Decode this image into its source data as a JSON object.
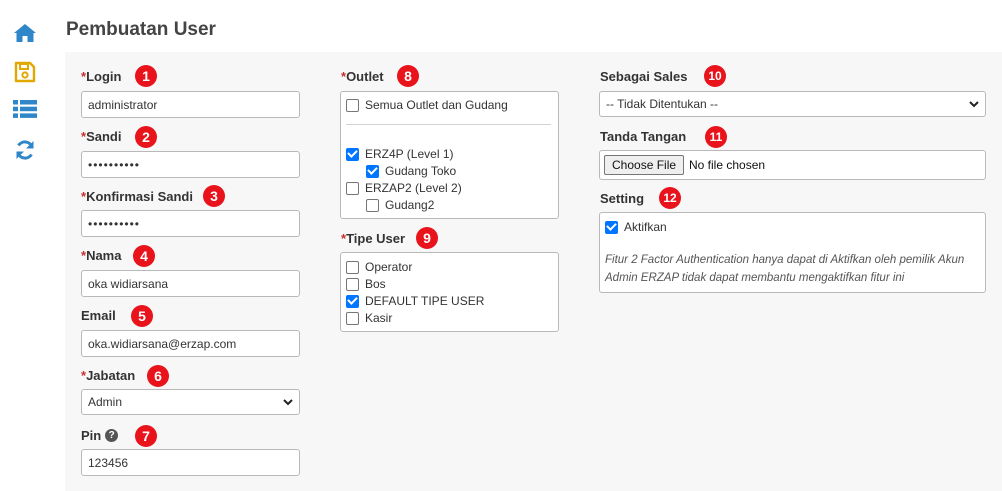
{
  "page": {
    "title": "Pembuatan User"
  },
  "sidebar": {
    "icons": [
      "home-icon",
      "save-icon",
      "list-icon",
      "refresh-icon"
    ]
  },
  "form": {
    "login": {
      "label": "Login",
      "required_mark": "*",
      "badge": "1",
      "value": "administrator"
    },
    "sandi": {
      "label": "Sandi",
      "required_mark": "*",
      "badge": "2",
      "value": "••••••••••"
    },
    "konfirmasi": {
      "label": "Konfirmasi Sandi",
      "required_mark": "*",
      "badge": "3",
      "value": "••••••••••"
    },
    "nama": {
      "label": "Nama",
      "required_mark": "*",
      "badge": "4",
      "value": "oka widiarsana"
    },
    "email": {
      "label": "Email",
      "badge": "5",
      "value": "oka.widiarsana@erzap.com"
    },
    "jabatan": {
      "label": "Jabatan",
      "required_mark": "*",
      "badge": "6",
      "value": "Admin"
    },
    "pin": {
      "label": "Pin",
      "badge": "7",
      "help": "?",
      "value": "123456"
    }
  },
  "outlet": {
    "label": "Outlet",
    "required_mark": "*",
    "badge": "8",
    "all_label": "Semua Outlet dan Gudang",
    "all_checked": false,
    "items": [
      {
        "label": "ERZ4P (Level 1)",
        "checked": true
      },
      {
        "label": "Gudang Toko",
        "checked": true
      },
      {
        "label": "ERZAP2 (Level 2)",
        "checked": false
      },
      {
        "label": "Gudang2",
        "checked": false
      }
    ]
  },
  "tipe_user": {
    "label": "Tipe User",
    "required_mark": "*",
    "badge": "9",
    "items": [
      {
        "label": "Operator",
        "checked": false
      },
      {
        "label": "Bos",
        "checked": false
      },
      {
        "label": "DEFAULT TIPE USER",
        "checked": true
      },
      {
        "label": "Kasir",
        "checked": false
      }
    ]
  },
  "sales": {
    "label": "Sebagai Sales",
    "badge": "10",
    "value": "-- Tidak Ditentukan --"
  },
  "signature": {
    "label": "Tanda Tangan",
    "badge": "11",
    "button": "Choose File",
    "status": "No file chosen"
  },
  "setting": {
    "label": "Setting",
    "badge": "12",
    "aktifkan_label": "Aktifkan",
    "aktifkan_checked": true,
    "note_line1": "Fitur 2 Factor Authentication hanya dapat di Aktifkan oleh pemilik Akun",
    "note_line2": "Admin ERZAP tidak dapat membantu mengaktifkan fitur ini"
  },
  "colors": {
    "sidebar_icon": "#2f86c8",
    "save_icon": "#e0a800",
    "badge": "#e8131b",
    "checkbox_on": "#0075ff"
  }
}
